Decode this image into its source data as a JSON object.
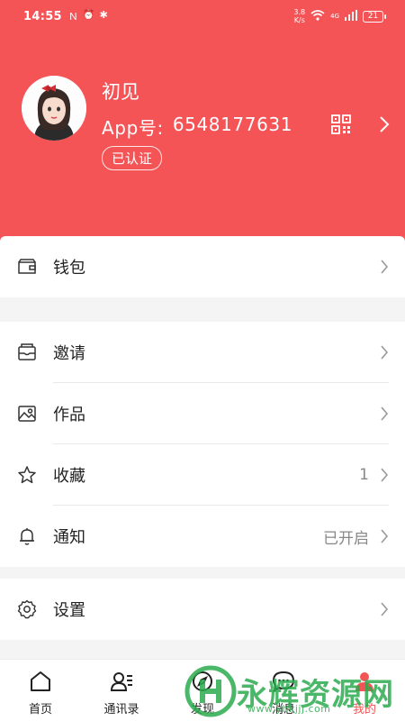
{
  "status_bar": {
    "time": "14:55",
    "net_speed_top": "3.8",
    "net_speed_bottom": "K/s",
    "signal_label": "4G",
    "battery": "21",
    "left_icons": [
      "nfc-icon",
      "alarm-icon",
      "bluetooth-icon"
    ]
  },
  "profile": {
    "name": "初见",
    "app_id_label": "App号:",
    "app_id": "6548177631",
    "verified_label": "已认证"
  },
  "menu": {
    "wallet": {
      "label": "钱包",
      "icon": "wallet-icon"
    },
    "invite": {
      "label": "邀请",
      "icon": "envelope-icon"
    },
    "works": {
      "label": "作品",
      "icon": "image-icon"
    },
    "favorites": {
      "label": "收藏",
      "value": "1",
      "icon": "star-icon"
    },
    "notifications": {
      "label": "通知",
      "value": "已开启",
      "icon": "bell-icon"
    },
    "settings": {
      "label": "设置",
      "icon": "gear-icon"
    }
  },
  "bottom_nav": {
    "home": "首页",
    "contacts": "通讯录",
    "discover": "发现",
    "messages": "消息",
    "me": "我的"
  },
  "watermark": {
    "text": "永辉资源网",
    "url": "www.yhkjjj.com"
  },
  "colors": {
    "accent": "#f55456",
    "watermark": "#2cab4f"
  }
}
